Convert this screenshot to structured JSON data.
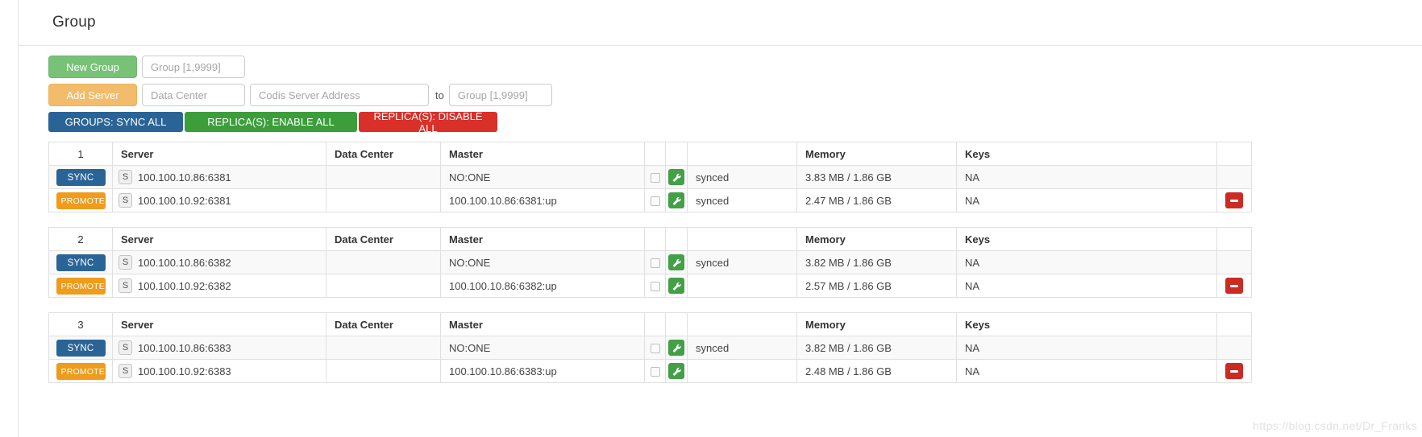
{
  "page": {
    "title": "Group",
    "watermark": "https://blog.csdn.net/Dr_Franks"
  },
  "toolbar": {
    "new_group_label": "New Group",
    "new_group_placeholder": "Group [1,9999]",
    "add_server_label": "Add Server",
    "data_center_placeholder": "Data Center",
    "server_address_placeholder": "Codis Server Address",
    "to_label": "to",
    "to_group_placeholder": "Group [1,9999]",
    "bulk": {
      "sync_all": "GROUPS: SYNC ALL",
      "enable_all": "REPLICA(S): ENABLE ALL",
      "disable_all": "REPLICA(S): DISABLE ALL"
    },
    "colors": {
      "new_group": "#77c277",
      "add_server": "#f2bc6a",
      "sync_all": "#2a6496",
      "enable_all": "#3b9e3b",
      "disable_all": "#d9302a"
    }
  },
  "table": {
    "headers": {
      "server": "Server",
      "data_center": "Data Center",
      "master": "Master",
      "memory": "Memory",
      "keys": "Keys"
    },
    "icons": {
      "role_badge": "S",
      "wrench": "wrench-icon",
      "delete": "minus-icon"
    },
    "colors": {
      "sync_button": "#2a6496",
      "promote_button": "#ef9b1b",
      "wrench_button": "#43a047",
      "delete_button": "#cc2b24"
    }
  },
  "groups": [
    {
      "id": "1",
      "rows": [
        {
          "action": "SYNC",
          "action_kind": "sync",
          "role": "S",
          "server": "100.100.10.86:6381",
          "data_center": "",
          "master": "NO:ONE",
          "state": "synced",
          "memory": "3.83 MB / 1.86 GB",
          "keys": "NA",
          "deletable": false
        },
        {
          "action": "PROMOTE",
          "action_kind": "promote",
          "role": "S",
          "server": "100.100.10.92:6381",
          "data_center": "",
          "master": "100.100.10.86:6381:up",
          "state": "synced",
          "memory": "2.47 MB / 1.86 GB",
          "keys": "NA",
          "deletable": true
        }
      ]
    },
    {
      "id": "2",
      "rows": [
        {
          "action": "SYNC",
          "action_kind": "sync",
          "role": "S",
          "server": "100.100.10.86:6382",
          "data_center": "",
          "master": "NO:ONE",
          "state": "synced",
          "memory": "3.82 MB / 1.86 GB",
          "keys": "NA",
          "deletable": false
        },
        {
          "action": "PROMOTE",
          "action_kind": "promote",
          "role": "S",
          "server": "100.100.10.92:6382",
          "data_center": "",
          "master": "100.100.10.86:6382:up",
          "state": "",
          "memory": "2.57 MB / 1.86 GB",
          "keys": "NA",
          "deletable": true
        }
      ]
    },
    {
      "id": "3",
      "rows": [
        {
          "action": "SYNC",
          "action_kind": "sync",
          "role": "S",
          "server": "100.100.10.86:6383",
          "data_center": "",
          "master": "NO:ONE",
          "state": "synced",
          "memory": "3.82 MB / 1.86 GB",
          "keys": "NA",
          "deletable": false
        },
        {
          "action": "PROMOTE",
          "action_kind": "promote",
          "role": "S",
          "server": "100.100.10.92:6383",
          "data_center": "",
          "master": "100.100.10.86:6383:up",
          "state": "",
          "memory": "2.48 MB / 1.86 GB",
          "keys": "NA",
          "deletable": true
        }
      ]
    }
  ]
}
